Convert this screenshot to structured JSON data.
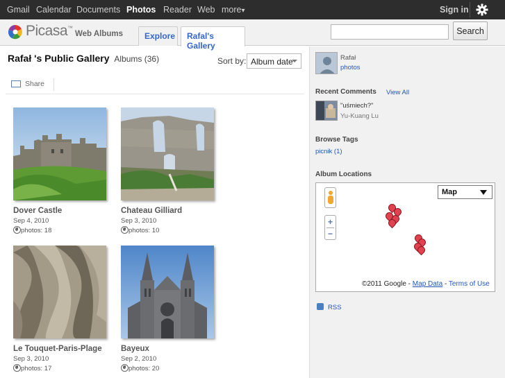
{
  "gbar": {
    "links": [
      "Gmail",
      "Calendar",
      "Documents",
      "Photos",
      "Reader",
      "Web",
      "more"
    ],
    "more_caret": "▾",
    "signin": "Sign in"
  },
  "header": {
    "logo_text": "Picasa",
    "logo_tm": "™",
    "logo_sub": "Web Albums",
    "tabs": [
      "Explore",
      "Rafal's Gallery"
    ],
    "search_value": "",
    "search_button": "Search"
  },
  "main": {
    "title": "Rafał 's Public Gallery",
    "albums_count": "Albums (36)",
    "sort_label": "Sort by:",
    "sort_value": "Album date",
    "share_label": "Share",
    "albums": [
      {
        "name": "Dover Castle",
        "date": "Sep 4, 2010",
        "photos": "photos: 18"
      },
      {
        "name": "Chateau Gilliard",
        "date": "Sep 3, 2010",
        "photos": "photos: 10"
      },
      {
        "name": "Le Touquet-Paris-Plage",
        "date": "Sep 3, 2010",
        "photos": "photos: 17"
      },
      {
        "name": "Bayeux",
        "date": "Sep 2, 2010",
        "photos": "photos: 20"
      }
    ]
  },
  "sidebar": {
    "user_name": "Rafał",
    "user_photos": "photos",
    "recent_comments": "Recent Comments",
    "view_all": "View All",
    "comment_text": "\"uśmiech?\"",
    "comment_author": "Yu-Kuang Lu",
    "browse_tags": "Browse Tags",
    "tag": "picnik (1)",
    "album_locations": "Album Locations",
    "map_type": "Map",
    "map_copyright": "©2011 Google -",
    "map_data": "Map Data",
    "map_sep": "-",
    "terms": "Terms of Use",
    "rss": "RSS"
  },
  "colors": {
    "link": "#2255bb",
    "tab_text": "#3366cc",
    "topbar": "#2d2d2d",
    "pin": "#e0424f"
  }
}
